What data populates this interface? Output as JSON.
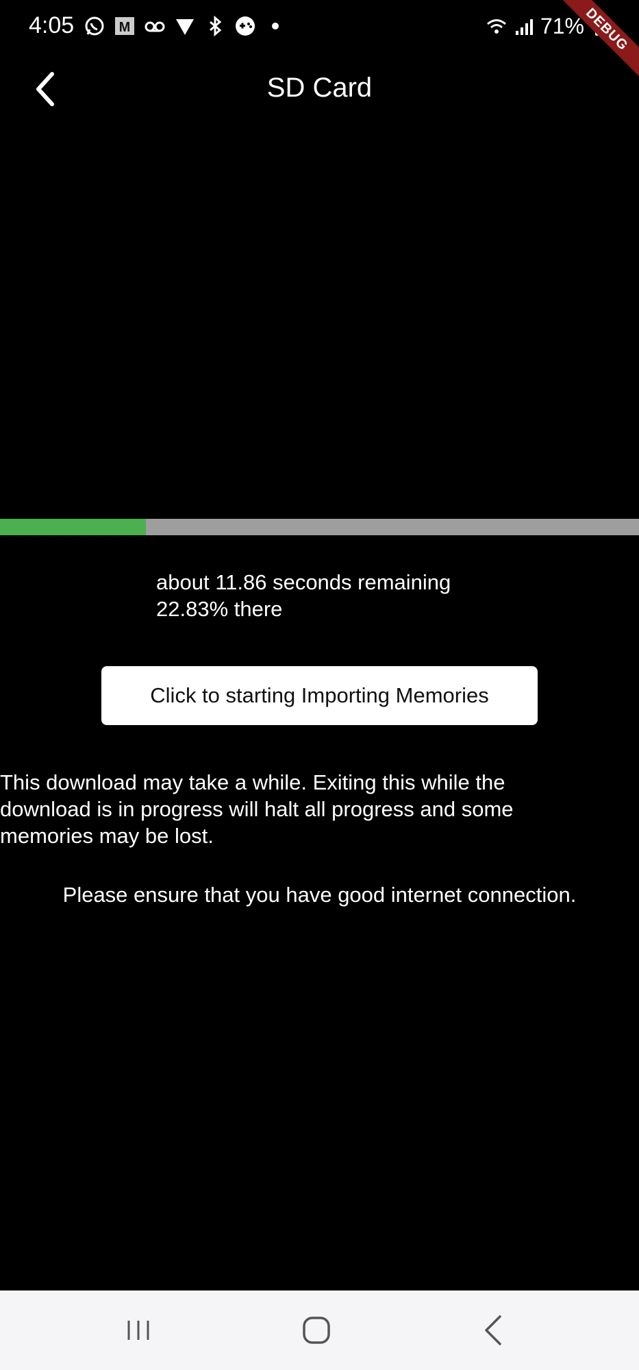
{
  "status_bar": {
    "time": "4:05",
    "battery": "71%",
    "icons_left": [
      "whatsapp-icon",
      "gmail-m-icon",
      "voicemail-icon",
      "shield-icon",
      "bluetooth-icon",
      "gamepad-icon",
      "dot-icon"
    ],
    "icons_right": [
      "wifi-icon",
      "signal-icon",
      "battery-icon"
    ]
  },
  "debug_banner": "DEBUG",
  "app_bar": {
    "title": "SD Card"
  },
  "progress": {
    "fraction": 0.2283,
    "fill_color": "#4caf50",
    "track_color": "#9e9e9e",
    "remaining_text": "about 11.86 seconds remaining",
    "percent_text": "22.83% there"
  },
  "import_button_label": "Click to starting Importing Memories",
  "warning_text": "This download may take a while. Exiting this while the download is in progress will halt all progress and some memories may be lost.",
  "ensure_text": "Please ensure that you have good internet connection.",
  "nav_bar": {
    "buttons": [
      "recent-apps-icon",
      "home-icon",
      "back-icon"
    ]
  }
}
